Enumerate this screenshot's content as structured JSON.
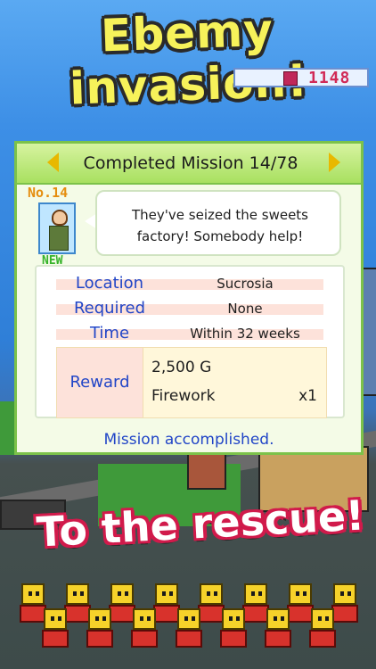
{
  "banner_top": {
    "text": "Ebemy invasion!"
  },
  "hud": {
    "gem_count": "1148",
    "gem_icon": "gem-icon"
  },
  "mission": {
    "header": "Completed Mission 14/78",
    "number_label": "No.14",
    "new_badge": "NEW",
    "speech": "They've seized the sweets factory! Somebody help!",
    "rows": [
      {
        "label": "Location",
        "value": "Sucrosia"
      },
      {
        "label": "Required",
        "value": "None"
      },
      {
        "label": "Time",
        "value": "Within 32 weeks"
      }
    ],
    "reward": {
      "label": "Reward",
      "gold": "2,500 G",
      "item": "Firework",
      "qty": "x1"
    },
    "status": "Mission accomplished."
  },
  "banner_bottom": {
    "text": "To the rescue!"
  },
  "colors": {
    "accent_green": "#7cc24a",
    "label_blue": "#2145c7",
    "gem_red": "#d12a57"
  }
}
